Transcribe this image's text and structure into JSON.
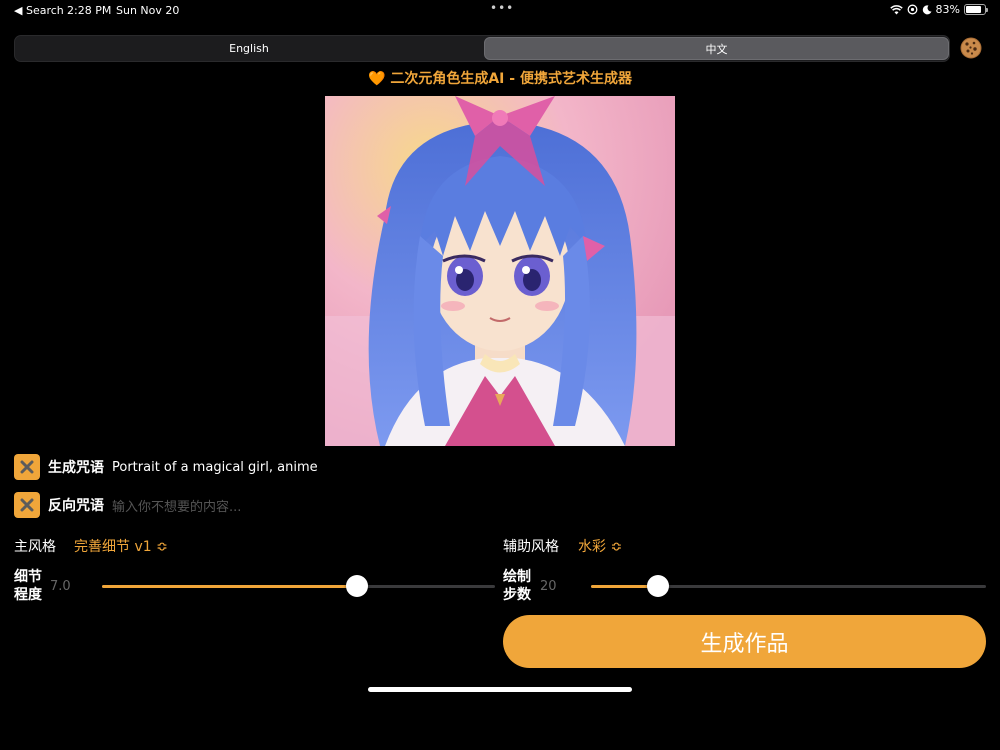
{
  "status_bar": {
    "back_label": "◀ Search",
    "time": "2:28 PM",
    "date": "Sun Nov 20",
    "battery": "83%",
    "battery_level": 0.83
  },
  "language_tabs": [
    {
      "label": "English",
      "selected": false
    },
    {
      "label": "中文",
      "selected": true
    }
  ],
  "app_title": "🧡 二次元角色生成AI - 便携式艺术生成器",
  "prompt": {
    "label": "生成咒语",
    "value": "Portrait of a magical girl, anime"
  },
  "negative_prompt": {
    "label": "反向咒语",
    "placeholder": "输入你不想要的内容..."
  },
  "main_style": {
    "label": "主风格",
    "value": "完善细节 v1 ≎"
  },
  "secondary_style": {
    "label": "辅助风格",
    "value": "水彩 ≎"
  },
  "detail_slider": {
    "label_line1": "细节",
    "label_line2": "程度",
    "value": "7.0",
    "fraction": 0.65
  },
  "steps_slider": {
    "label_line1": "绘制",
    "label_line2": "步数",
    "value": "20",
    "fraction": 0.17
  },
  "generate_button": "生成作品",
  "colors": {
    "accent": "#f0a63a",
    "background": "#000000"
  }
}
